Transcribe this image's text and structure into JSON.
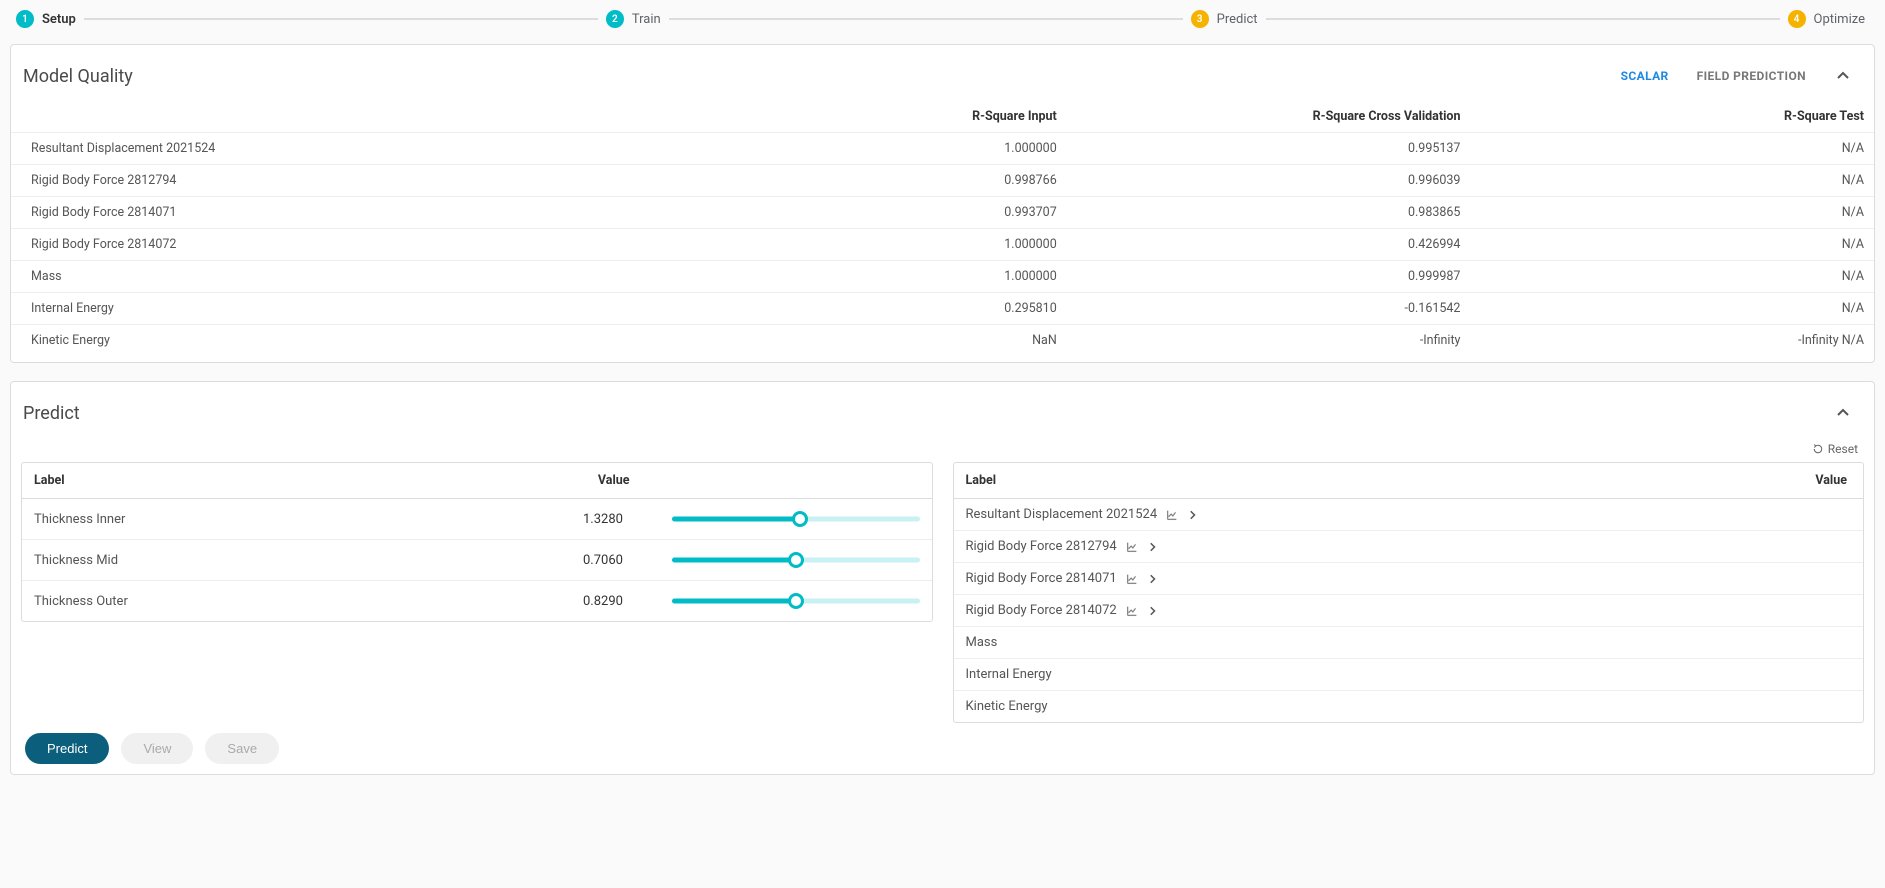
{
  "stepper": {
    "steps": [
      {
        "num": "1",
        "label": "Setup",
        "color": "teal",
        "strong": true
      },
      {
        "num": "2",
        "label": "Train",
        "color": "teal",
        "strong": false
      },
      {
        "num": "3",
        "label": "Predict",
        "color": "amber",
        "strong": false
      },
      {
        "num": "4",
        "label": "Optimize",
        "color": "amber",
        "strong": false
      }
    ]
  },
  "modelQuality": {
    "title": "Model Quality",
    "tabs": {
      "scalar": "SCALAR",
      "field": "FIELD PREDICTION",
      "active": "scalar"
    },
    "columns": {
      "name": "",
      "rsq_input": "R-Square Input",
      "rsq_cv": "R-Square Cross Validation",
      "rsq_test": "R-Square Test"
    },
    "rows": [
      {
        "name": "Resultant Displacement 2021524",
        "rsq_input": "1.000000",
        "rsq_cv": "0.995137",
        "rsq_test": "N/A"
      },
      {
        "name": "Rigid Body Force 2812794",
        "rsq_input": "0.998766",
        "rsq_cv": "0.996039",
        "rsq_test": "N/A"
      },
      {
        "name": "Rigid Body Force 2814071",
        "rsq_input": "0.993707",
        "rsq_cv": "0.983865",
        "rsq_test": "N/A"
      },
      {
        "name": "Rigid Body Force 2814072",
        "rsq_input": "1.000000",
        "rsq_cv": "0.426994",
        "rsq_test": "N/A"
      },
      {
        "name": "Mass",
        "rsq_input": "1.000000",
        "rsq_cv": "0.999987",
        "rsq_test": "N/A"
      },
      {
        "name": "Internal Energy",
        "rsq_input": "0.295810",
        "rsq_cv": "-0.161542",
        "rsq_test": "N/A"
      },
      {
        "name": "Kinetic Energy",
        "rsq_input": "NaN",
        "rsq_cv": "-Infinity",
        "rsq_test": "-Infinity N/A"
      }
    ]
  },
  "predict": {
    "title": "Predict",
    "reset_label": "Reset",
    "inputs": {
      "columns": {
        "label": "Label",
        "value": "Value"
      },
      "rows": [
        {
          "label": "Thickness Inner",
          "value": "1.3280",
          "pct": 52
        },
        {
          "label": "Thickness Mid",
          "value": "0.7060",
          "pct": 50
        },
        {
          "label": "Thickness Outer",
          "value": "0.8290",
          "pct": 50
        }
      ]
    },
    "outputs": {
      "columns": {
        "label": "Label",
        "value": "Value"
      },
      "rows": [
        {
          "label": "Resultant Displacement 2021524",
          "has_chart": true
        },
        {
          "label": "Rigid Body Force 2812794",
          "has_chart": true
        },
        {
          "label": "Rigid Body Force 2814071",
          "has_chart": true
        },
        {
          "label": "Rigid Body Force 2814072",
          "has_chart": true
        },
        {
          "label": "Mass",
          "has_chart": false
        },
        {
          "label": "Internal Energy",
          "has_chart": false
        },
        {
          "label": "Kinetic Energy",
          "has_chart": false
        }
      ]
    },
    "buttons": {
      "predict": "Predict",
      "view": "View",
      "save": "Save"
    }
  }
}
